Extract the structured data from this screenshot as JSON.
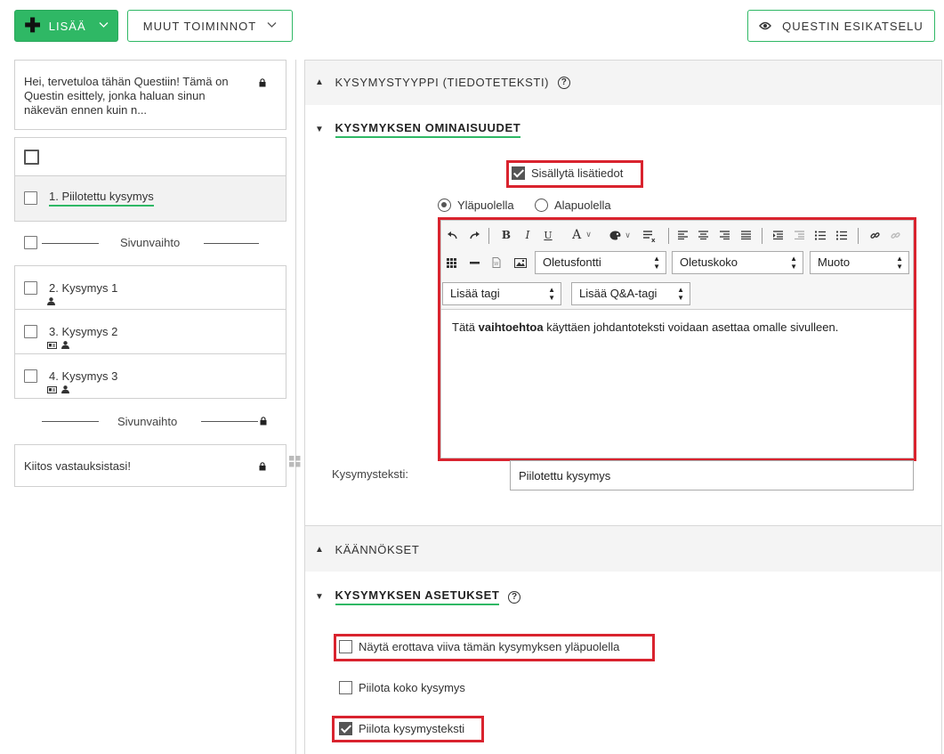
{
  "topbar": {
    "add_label": "LISÄÄ",
    "more_label": "MUUT TOIMINNOT",
    "preview_label": "QUESTIN ESIKATSELU"
  },
  "sidebar": {
    "intro_text": "Hei, tervetuloa tähän Questiin! Tämä on Questin esittely, jonka haluan sinun näkevän ennen kuin n...",
    "questions": [
      {
        "label": "1.  Piilotettu kysymys"
      },
      {
        "label": "2.  Kysymys 1"
      },
      {
        "label": "3.  Kysymys 2"
      },
      {
        "label": "4.  Kysymys 3"
      }
    ],
    "pagebreak_1": "Sivunvaihto",
    "pagebreak_2": "Sivunvaihto",
    "outro_text": "Kiitos vastauksistasi!"
  },
  "main": {
    "question_type_header": "KYSYMYSTYYPPI (TIEDOTETEKSTI)",
    "properties_header": "KYSYMYKSEN OMINAISUUDET",
    "include_details_label": "Sisällytä lisätiedot",
    "include_details_checked": true,
    "position_above_label": "Yläpuolella",
    "position_below_label": "Alapuolella",
    "position_selected": "above",
    "editor": {
      "font_select": "Oletusfontti",
      "size_select": "Oletuskoko",
      "format_select": "Muoto",
      "tag_select": "Lisää tagi",
      "qa_tag_select": "Lisää Q&A-tagi",
      "content_before": "Tätä ",
      "content_bold": "vaihtoehtoa",
      "content_after": " käyttäen johdantoteksti voidaan asettaa omalle sivulleen."
    },
    "question_text_label": "Kysymysteksti:",
    "question_text_value": "Piilotettu kysymys",
    "translations_header": "KÄÄNNÖKSET",
    "settings_header": "KYSYMYKSEN ASETUKSET",
    "settings": {
      "show_divider_label": "Näytä erottava viiva tämän kysymyksen yläpuolella",
      "show_divider_checked": false,
      "hide_question_label": "Piilota koko kysymys",
      "hide_question_checked": false,
      "hide_text_label": "Piilota kysymysteksti",
      "hide_text_checked": true
    }
  },
  "colors": {
    "accent_green": "#2fb865",
    "highlight_red": "#d9232e"
  }
}
